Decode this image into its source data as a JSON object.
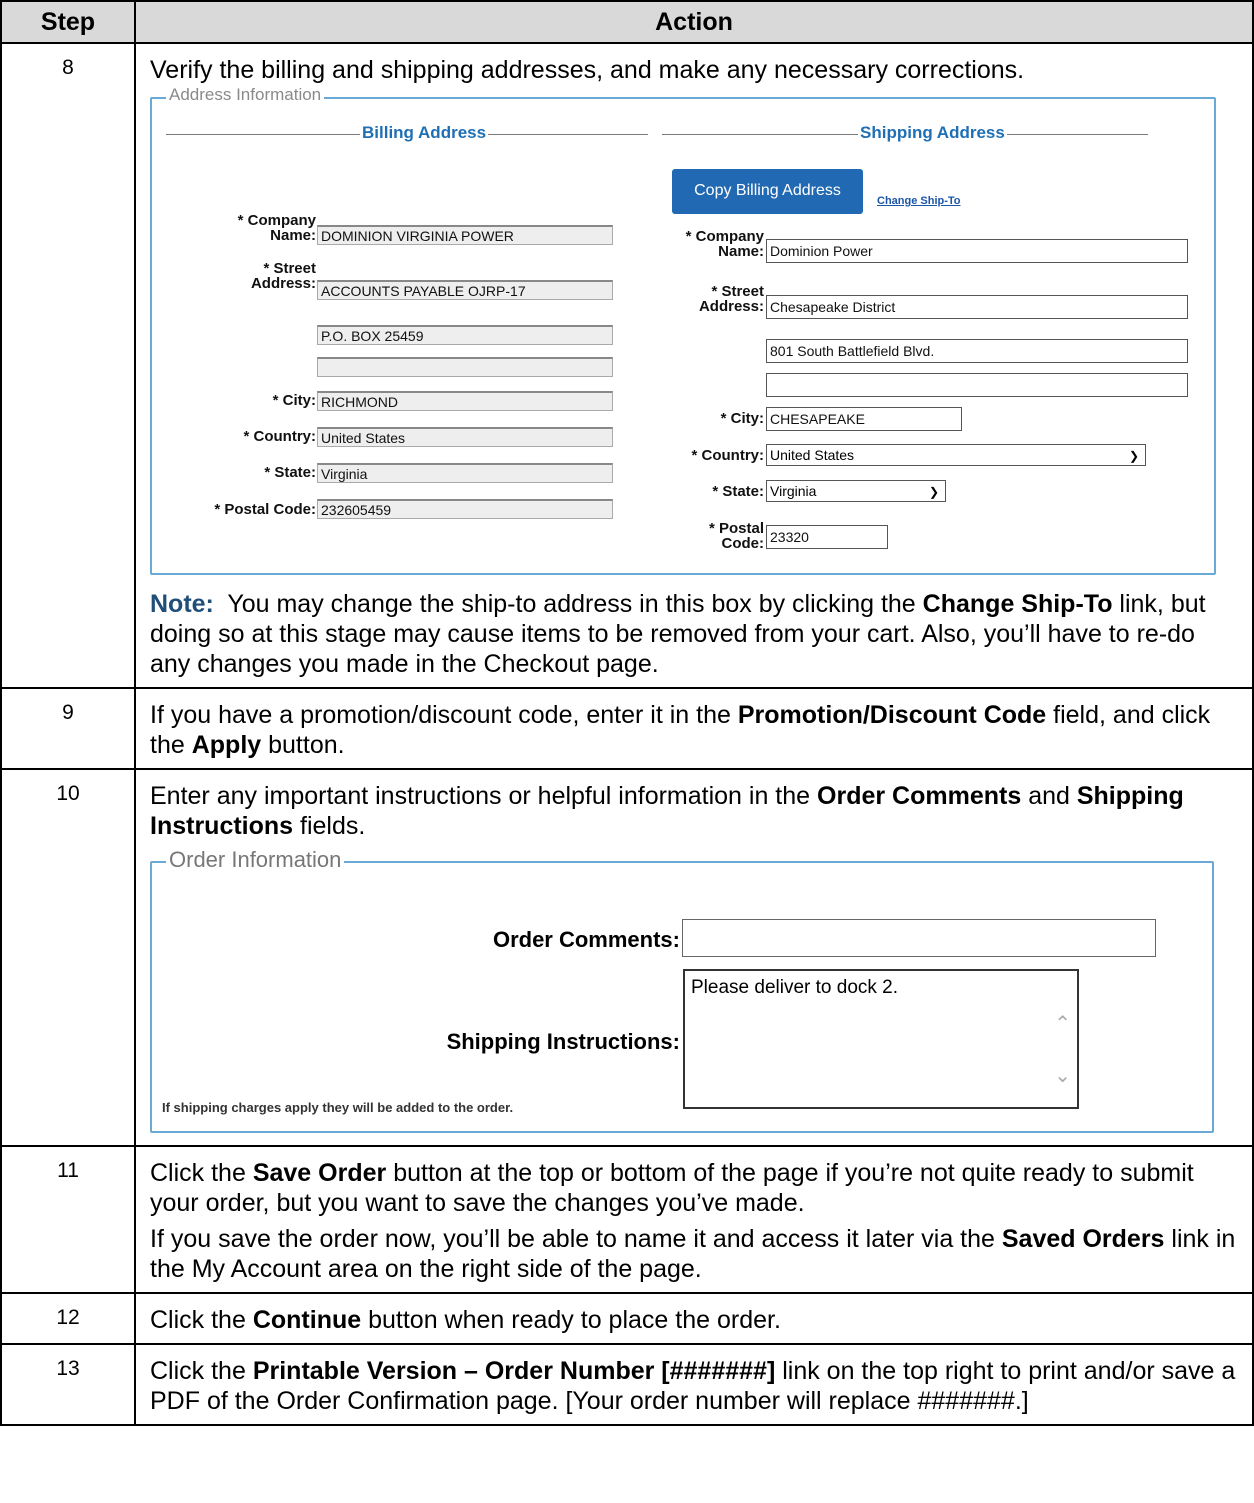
{
  "table": {
    "header_step": "Step",
    "header_action": "Action"
  },
  "step8": {
    "num": "8",
    "intro": "Verify the billing and shipping addresses, and make any necessary corrections.",
    "note_label": "Note:",
    "note_1": "You may change the ship-to address in this box by clicking the",
    "note_bold1": "Change Ship-To",
    "note_2": "link, but doing so at this stage may cause items to be removed from your cart. Also, you’ll have to re-do any changes you made in the Checkout page."
  },
  "address_form": {
    "legend": "Address Information",
    "billing_header": "Billing Address",
    "shipping_header": "Shipping Address",
    "copy_button": "Copy Billing Address",
    "change_link": "Change Ship-To",
    "labels": {
      "company_line1": "* Company",
      "company_line2": "Name:",
      "street_line1": "* Street",
      "street_line2": "Address:",
      "city": "* City:",
      "country": "* Country:",
      "state": "* State:",
      "postal": "* Postal Code:",
      "postal_line1": "* Postal",
      "postal_line2": "Code:"
    },
    "billing": {
      "company": "DOMINION VIRGINIA POWER",
      "street1": "ACCOUNTS PAYABLE OJRP-17",
      "street2": "P.O. BOX 25459",
      "street3": "",
      "city": "RICHMOND",
      "country": "United States",
      "state": "Virginia",
      "postal": "232605459"
    },
    "shipping": {
      "company": "Dominion Power",
      "street1": "Chesapeake District",
      "street2": "801 South Battlefield Blvd.",
      "street3": "",
      "city": "CHESAPEAKE",
      "country": "United States",
      "state": "Virginia",
      "postal": "23320"
    }
  },
  "step9": {
    "num": "9",
    "t1": "If you have a promotion/discount code, enter it in the",
    "b1": "Promotion/Discount Code",
    "t2": "field, and click the",
    "b2": "Apply",
    "t3": "button."
  },
  "step10": {
    "num": "10",
    "t1": "Enter any important instructions or helpful information in the",
    "b1": "Order Comments",
    "t2": "and",
    "b2": "Shipping Instructions",
    "t3": "fields."
  },
  "order_form": {
    "legend": "Order Information",
    "comments_label": "Order Comments:",
    "comments_value": "",
    "shipping_label": "Shipping Instructions:",
    "shipping_value": "Please deliver to dock 2.",
    "fineprint": "If shipping charges apply they will be added to the order."
  },
  "step11": {
    "num": "11",
    "t1": "Click the",
    "b1": "Save Order",
    "t2": "button at the top or bottom of the page if you’re not quite ready to submit your order, but you want to save the changes you’ve made.",
    "t3": "If you save the order now, you’ll be able to name it and access it later via the",
    "b2": "Saved Orders",
    "t4": "link in the My Account area on the right side of the page."
  },
  "step12": {
    "num": "12",
    "t1": "Click the",
    "b1": "Continue",
    "t2": "button when ready to place the order."
  },
  "step13": {
    "num": "13",
    "t1": "Click the",
    "b1": "Printable Version – Order Number [#######]",
    "t2": "link on the top right to print and/or save a PDF of the Order Confirmation page. [Your order number will replace #######.]"
  }
}
